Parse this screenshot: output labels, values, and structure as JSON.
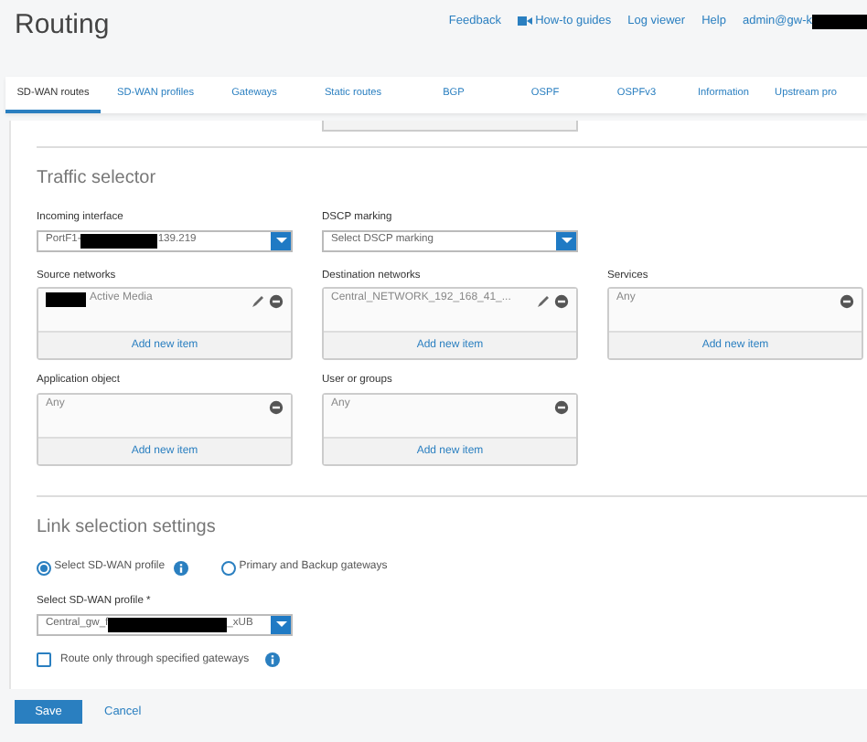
{
  "header": {
    "title": "Routing",
    "links": [
      {
        "label": "Feedback",
        "kind": "text"
      },
      {
        "label": "How-to guides",
        "kind": "video"
      },
      {
        "label": "Log viewer",
        "kind": "text"
      },
      {
        "label": "Help",
        "kind": "text"
      }
    ],
    "user": [
      {
        "kind": "text",
        "text": "admin@gw-k"
      },
      {
        "kind": "redacted"
      }
    ]
  },
  "tabs": [
    {
      "label": "SD-WAN routes",
      "selected": true
    },
    {
      "label": "SD-WAN profiles",
      "selected": false
    },
    {
      "label": "Gateways",
      "selected": false
    },
    {
      "label": "Static routes",
      "selected": false
    },
    {
      "label": "BGP",
      "selected": false
    },
    {
      "label": "OSPF",
      "selected": false
    },
    {
      "label": "OSPFv3",
      "selected": false
    },
    {
      "label": "Information",
      "selected": false
    },
    {
      "label": "Upstream pro",
      "selected": false
    }
  ],
  "traffic_selector": {
    "title": "Traffic selector",
    "incoming_interface": {
      "label": "Incoming interface",
      "value": [
        {
          "kind": "text",
          "text": "PortF1-"
        },
        {
          "kind": "redacted"
        },
        {
          "kind": "text",
          "text": "139.219"
        }
      ]
    },
    "dscp_marking": {
      "label": "DSCP marking",
      "placeholder": "Select DSCP marking"
    },
    "lists": [
      {
        "label": "Source networks",
        "items": [
          {
            "value": [
              {
                "kind": "redacted"
              },
              {
                "kind": "text",
                "text": "Active Media"
              }
            ],
            "editable": true
          }
        ],
        "add": "Add new item"
      },
      {
        "label": "Destination networks",
        "items": [
          {
            "value": [
              {
                "kind": "text",
                "text": "Central_NETWORK_192_168_41_..."
              }
            ],
            "editable": true
          }
        ],
        "add": "Add new item"
      },
      {
        "label": "Services",
        "items": [
          {
            "value": [
              {
                "kind": "text",
                "text": "Any"
              }
            ],
            "editable": false
          }
        ],
        "add": "Add new item"
      },
      {
        "label": "Application object",
        "items": [
          {
            "value": [
              {
                "kind": "text",
                "text": "Any"
              }
            ],
            "editable": false
          }
        ],
        "add": "Add new item"
      },
      {
        "label": "User or groups",
        "items": [
          {
            "value": [
              {
                "kind": "text",
                "text": "Any"
              }
            ],
            "editable": false
          }
        ],
        "add": "Add new item"
      }
    ]
  },
  "link_selection": {
    "title": "Link selection settings",
    "options": [
      {
        "label": "Select SD-WAN profile",
        "selected": true,
        "info": true
      },
      {
        "label": "Primary and Backup gateways",
        "selected": false,
        "info": false
      }
    ],
    "profile": {
      "label": "Select SD-WAN profile",
      "required_mark": "*",
      "value": [
        {
          "kind": "text",
          "text": "Central_gw_f"
        },
        {
          "kind": "redacted"
        },
        {
          "kind": "text",
          "text": "_xUB"
        }
      ]
    },
    "route_only": {
      "label": "Route only through specified gateways",
      "checked": false,
      "info": true
    }
  },
  "footer": {
    "save": "Save",
    "cancel": "Cancel"
  }
}
